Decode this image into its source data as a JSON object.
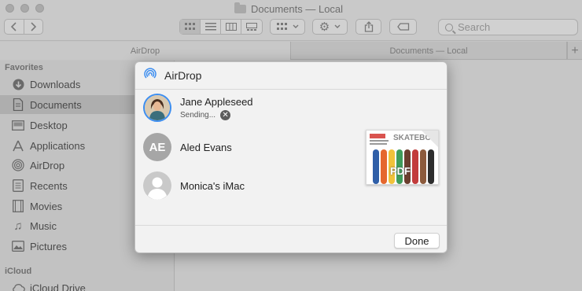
{
  "window": {
    "title": "Documents — Local",
    "search_placeholder": "Search"
  },
  "tabs": [
    {
      "label": "AirDrop"
    },
    {
      "label": "Documents — Local"
    }
  ],
  "tab_add_label": "+",
  "sidebar": {
    "favorites_heading": "Favorites",
    "items": [
      {
        "label": "Downloads",
        "icon": "download-icon"
      },
      {
        "label": "Documents",
        "icon": "document-icon",
        "selected": true
      },
      {
        "label": "Desktop",
        "icon": "desktop-icon"
      },
      {
        "label": "Applications",
        "icon": "applications-icon"
      },
      {
        "label": "AirDrop",
        "icon": "airdrop-icon"
      },
      {
        "label": "Recents",
        "icon": "recents-icon"
      },
      {
        "label": "Movies",
        "icon": "movies-icon"
      },
      {
        "label": "Music",
        "icon": "music-icon"
      },
      {
        "label": "Pictures",
        "icon": "pictures-icon"
      }
    ],
    "icloud_heading": "iCloud",
    "icloud_items": [
      {
        "label": "iCloud Drive",
        "icon": "cloud-icon"
      }
    ]
  },
  "airdrop_sheet": {
    "title": "AirDrop",
    "people": [
      {
        "name": "Jane Appleseed",
        "status": "Sending...",
        "avatar": "photo"
      },
      {
        "name": "Aled Evans",
        "initials": "AE"
      },
      {
        "name": "Monica's iMac",
        "avatar": "generic"
      }
    ],
    "file_type_label": "PDF",
    "file_thumbnail_text": "SKATEBO",
    "done_label": "Done"
  },
  "colors": {
    "airdrop_blue": "#3d8ef0",
    "sheet_bg": "#f2f2f2"
  }
}
